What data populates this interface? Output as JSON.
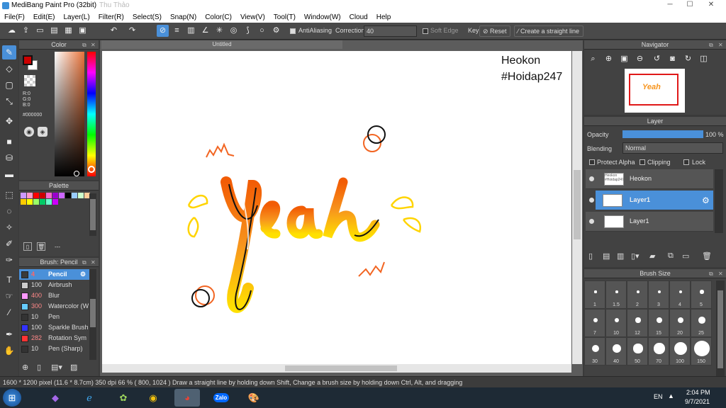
{
  "window": {
    "title": "MediBang Paint Pro (32bit)",
    "ghost_title": "Thu Thảo"
  },
  "menu": [
    "File(F)",
    "Edit(E)",
    "Layer(L)",
    "Filter(R)",
    "Select(S)",
    "Snap(N)",
    "Color(C)",
    "View(V)",
    "Tool(T)",
    "Window(W)",
    "Cloud",
    "Help"
  ],
  "toolbar": {
    "antialiasing_label": "AntiAliasing",
    "correction_label": "Correction",
    "correction_value": "40",
    "soft_edge_label": "Soft Edge",
    "key_label": "Key",
    "reset_label": "Reset",
    "straight_line_label": "Create a straight line"
  },
  "color_panel": {
    "title": "Color",
    "r": "R:0",
    "g": "G:0",
    "b": "B:0",
    "hex": "#000000",
    "main_color": "#cc0000",
    "sub_color": "#ffffff"
  },
  "palette": {
    "title": "Palette",
    "swatches": [
      "#cc99ff",
      "#ff99cc",
      "#ff0000",
      "#cc0000",
      "#ff66cc",
      "#9900cc",
      "#cc66ff",
      "#000000",
      "#99ccff",
      "#ccffcc",
      "#ffcc99",
      "#ffcc00",
      "#ffff00",
      "#99ff66",
      "#00cc66",
      "#66ffcc",
      "#cc00ff"
    ],
    "current_label": "---"
  },
  "brush_panel": {
    "title": "Brush: Pencil",
    "brushes": [
      {
        "size": "4",
        "name": "Pencil",
        "color": "#3a3a3a",
        "selected": true
      },
      {
        "size": "100",
        "name": "Airbrush",
        "color": "#cccccc"
      },
      {
        "size": "400",
        "name": "Blur",
        "color": "#ff99ff"
      },
      {
        "size": "300",
        "name": "Watercolor (W",
        "color": "#66ccff"
      },
      {
        "size": "10",
        "name": "Pen",
        "color": "#333333"
      },
      {
        "size": "100",
        "name": "Sparkle Brush",
        "color": "#3333ff"
      },
      {
        "size": "282",
        "name": "Rotation Sym",
        "color": "#ff3333"
      },
      {
        "size": "10",
        "name": "Pen (Sharp)",
        "color": "#333333"
      }
    ]
  },
  "document": {
    "tab_title": "Untitled",
    "canvas_text_1": "Heokon",
    "canvas_text_2": "#Hoidap247",
    "artwork_text": "Yeah"
  },
  "navigator": {
    "title": "Navigator",
    "preview_text": "Yeah"
  },
  "layer_panel": {
    "title": "Layer",
    "opacity_label": "Opacity",
    "opacity_value": "100 %",
    "opacity": 1.0,
    "blending_label": "Blending",
    "blending_value": "Normal",
    "protect_alpha_label": "Protect Alpha",
    "clipping_label": "Clipping",
    "lock_label": "Lock",
    "layers": [
      {
        "name": "Heokon",
        "thumb": "Heokon #Hoidap247"
      },
      {
        "name": "Layer1",
        "thumb": "",
        "selected": true
      },
      {
        "name": "Layer1",
        "thumb": ""
      }
    ]
  },
  "brush_size": {
    "title": "Brush Size",
    "sizes": [
      1,
      1.5,
      2,
      3,
      4,
      5,
      7,
      10,
      12,
      15,
      20,
      25,
      30,
      40,
      50,
      70,
      100,
      150
    ]
  },
  "status": {
    "text": "1600 * 1200 pixel  (11.6 * 8.7cm)  350 dpi  66 %  ( 800, 1024 )  Draw a straight line by holding down Shift, Change a brush size by holding down Ctrl, Alt, and dragging"
  },
  "taskbar": {
    "lang": "EN",
    "time": "2:04 PM",
    "date": "9/7/2021",
    "zalo_label": "Zalo"
  },
  "colors": {
    "accent": "#4a90d9",
    "panel": "#424242",
    "orange": "#f7941d",
    "yellow": "#ffd400"
  }
}
